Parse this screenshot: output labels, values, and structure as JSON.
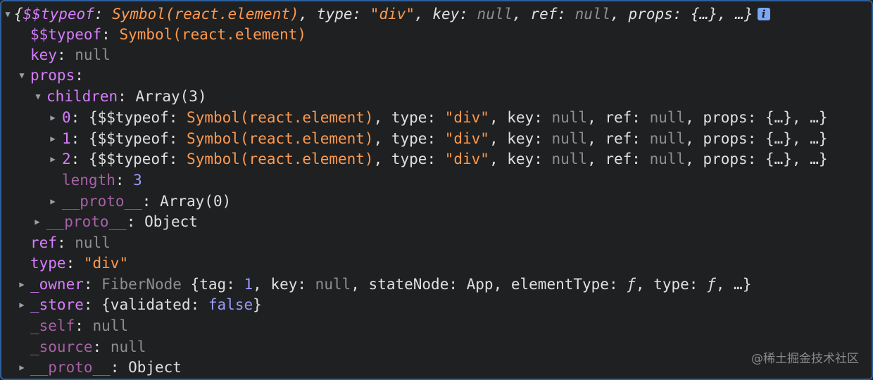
{
  "root": {
    "summary": {
      "sym_key": "$$typeof",
      "sym_val": "Symbol(react.element)",
      "type_key": "type",
      "type_val": "\"div\"",
      "key_key": "key",
      "key_val": "null",
      "ref_key": "ref",
      "ref_val": "null",
      "props_key": "props",
      "props_val": "{…}",
      "ellipsis": "…"
    },
    "info_badge": "i",
    "typeof": {
      "key": "$$typeof",
      "value": "Symbol(react.element)"
    },
    "key": {
      "key": "key",
      "value": "null"
    },
    "props": {
      "key": "props",
      "children": {
        "key": "children",
        "value": "Array(3)",
        "items": [
          {
            "index": "0",
            "sym_key": "$$typeof",
            "sym_val": "Symbol(react.element)",
            "type_key": "type",
            "type_val": "\"div\"",
            "key_key": "key",
            "key_val": "null",
            "ref_key": "ref",
            "ref_val": "null",
            "props_key": "props",
            "props_val": "{…}",
            "ellipsis": "…"
          },
          {
            "index": "1",
            "sym_key": "$$typeof",
            "sym_val": "Symbol(react.element)",
            "type_key": "type",
            "type_val": "\"div\"",
            "key_key": "key",
            "key_val": "null",
            "ref_key": "ref",
            "ref_val": "null",
            "props_key": "props",
            "props_val": "{…}",
            "ellipsis": "…"
          },
          {
            "index": "2",
            "sym_key": "$$typeof",
            "sym_val": "Symbol(react.element)",
            "type_key": "type",
            "type_val": "\"div\"",
            "key_key": "key",
            "key_val": "null",
            "ref_key": "ref",
            "ref_val": "null",
            "props_key": "props",
            "props_val": "{…}",
            "ellipsis": "…"
          }
        ],
        "length": {
          "key": "length",
          "value": "3"
        },
        "proto": {
          "key": "__proto__",
          "value": "Array(0)"
        }
      },
      "proto": {
        "key": "__proto__",
        "value": "Object"
      }
    },
    "ref": {
      "key": "ref",
      "value": "null"
    },
    "type": {
      "key": "type",
      "value": "\"div\""
    },
    "owner": {
      "key": "_owner",
      "class": "FiberNode",
      "tag_key": "tag",
      "tag_val": "1",
      "key_key": "key",
      "key_val": "null",
      "state_key": "stateNode",
      "state_val": "App",
      "etype_key": "elementType",
      "etype_val": "ƒ",
      "type_key": "type",
      "type_val": "ƒ",
      "ellipsis": "…"
    },
    "store": {
      "key": "_store",
      "inner_key": "validated",
      "inner_val": "false"
    },
    "self": {
      "key": "_self",
      "value": "null"
    },
    "source": {
      "key": "_source",
      "value": "null"
    },
    "proto": {
      "key": "__proto__",
      "value": "Object"
    }
  },
  "watermark": "@稀土掘金技术社区"
}
